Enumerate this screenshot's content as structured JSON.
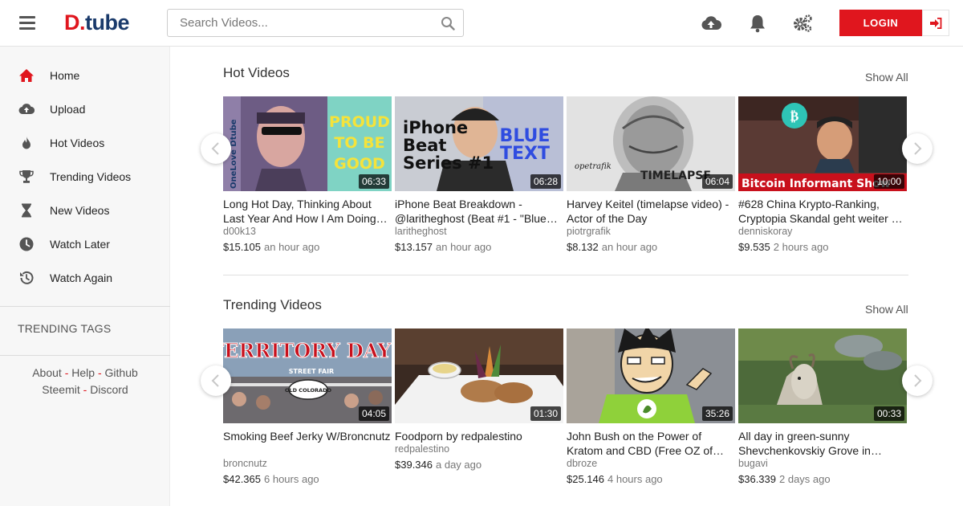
{
  "header": {
    "logo": {
      "brand": "D",
      "rest": "tube"
    },
    "search_placeholder": "Search Videos...",
    "login_label": "LOGIN"
  },
  "sidebar": {
    "items": [
      {
        "label": "Home",
        "icon": "home-icon"
      },
      {
        "label": "Upload",
        "icon": "cloud-upload-icon"
      },
      {
        "label": "Hot Videos",
        "icon": "fire-icon"
      },
      {
        "label": "Trending Videos",
        "icon": "trophy-icon"
      },
      {
        "label": "New Videos",
        "icon": "hourglass-icon"
      },
      {
        "label": "Watch Later",
        "icon": "clock-icon"
      },
      {
        "label": "Watch Again",
        "icon": "history-icon"
      }
    ],
    "trending_tags_label": "TRENDING TAGS",
    "links": {
      "about": "About",
      "help": "Help",
      "github": "Github",
      "steemit": "Steemit",
      "discord": "Discord",
      "separator": "-"
    }
  },
  "colors": {
    "accent": "#e0161e",
    "brand": "#1a3a6b"
  },
  "hot_videos": {
    "title": "Hot Videos",
    "show_all": "Show All",
    "items": [
      {
        "title": "Long Hot Day, Thinking About Last Year And How I Am Doing…",
        "author": "d00k13",
        "price": "$15.105",
        "time": "an hour ago",
        "duration": "06:33"
      },
      {
        "title": "iPhone Beat Breakdown - @laritheghost (Beat #1 - \"Blue…",
        "author": "laritheghost",
        "price": "$13.157",
        "time": "an hour ago",
        "duration": "06:28"
      },
      {
        "title": "Harvey Keitel (timelapse video) - Actor of the Day",
        "author": "piotrgrafik",
        "price": "$8.132",
        "time": "an hour ago",
        "duration": "06:04"
      },
      {
        "title": "#628 China Krypto-Ranking, Cryptopia Skandal geht weiter …",
        "author": "denniskoray",
        "price": "$9.535",
        "time": "2 hours ago",
        "duration": "10:00"
      }
    ]
  },
  "trending_videos": {
    "title": "Trending Videos",
    "show_all": "Show All",
    "items": [
      {
        "title": "Smoking Beef Jerky W/Broncnutz",
        "author": "broncnutz",
        "price": "$42.365",
        "time": "6 hours ago",
        "duration": "04:05"
      },
      {
        "title": "Foodporn by redpalestino",
        "author": "redpalestino",
        "price": "$39.346",
        "time": "a day ago",
        "duration": "01:30"
      },
      {
        "title": "John Bush on the Power of Kratom and CBD (Free OZ of…",
        "author": "dbroze",
        "price": "$25.146",
        "time": "4 hours ago",
        "duration": "35:26"
      },
      {
        "title": "All day in green-sunny Shevchenkovskiy Grove in…",
        "author": "bugavi",
        "price": "$36.339",
        "time": "2 days ago",
        "duration": "00:33"
      }
    ]
  },
  "thumbnails": {
    "proud_text": [
      "PROUD",
      "TO BE",
      "GOOD"
    ],
    "one_love_text": "OneLove Dtube",
    "iphone_text": [
      "iPhone",
      "Beat",
      "Series #1"
    ],
    "blue_text": [
      "BLUE",
      "TEXT"
    ],
    "timelapse_text": "TIMELAPSE",
    "signature_text": "opetrafik",
    "bitcoin_text": "Bitcoin Informant Show",
    "territory_text": "TERRITORY DAYS",
    "street_fair_text": "STREET FAIR",
    "old_colorado_text": "OLD COLORADO"
  }
}
